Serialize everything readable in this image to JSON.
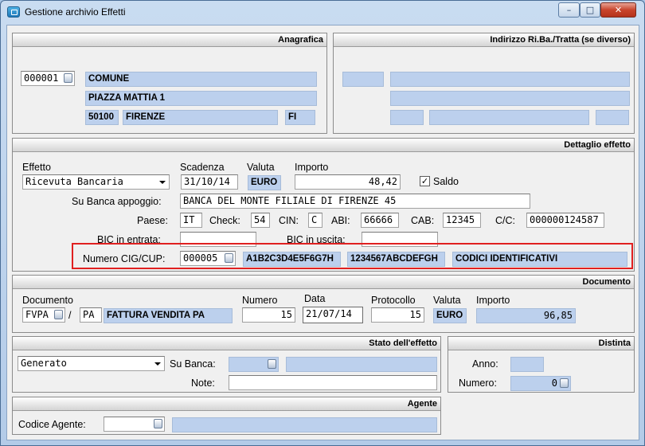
{
  "window": {
    "title": "Gestione archivio Effetti",
    "min_icon": "minimize-icon",
    "max_icon": "maximize-icon",
    "close_icon": "close-icon",
    "min_glyph": "–",
    "max_glyph": "□",
    "close_glyph": "✕"
  },
  "anagrafica": {
    "header": "Anagrafica",
    "code": "000001",
    "name": "COMUNE",
    "address": "PIAZZA MATTIA 1",
    "cap": "50100",
    "city": "FIRENZE",
    "province": "FI"
  },
  "indirizzo": {
    "header": "Indirizzo Ri.Ba./Tratta (se diverso)"
  },
  "dettaglio": {
    "header": "Dettaglio effetto",
    "effetto_label": "Effetto",
    "effetto_value": "Ricevuta Bancaria",
    "scadenza_label": "Scadenza",
    "scadenza_value": "31/10/14",
    "valuta_label": "Valuta",
    "valuta_value": "EURO",
    "importo_label": "Importo",
    "importo_value": "48,42",
    "saldo_label": "Saldo",
    "saldo_checked": "✓",
    "banca_label": "Su Banca appoggio:",
    "banca_value": "BANCA DEL MONTE FILIALE DI FIRENZE 45",
    "paese_label": "Paese:",
    "paese_value": "IT",
    "check_label": "Check:",
    "check_value": "54",
    "cin_label": "CIN:",
    "cin_value": "C",
    "abi_label": "ABI:",
    "abi_value": "66666",
    "cab_label": "CAB:",
    "cab_value": "12345",
    "cc_label": "C/C:",
    "cc_value": "000000124587",
    "bic_in_label": "BIC in entrata:",
    "bic_out_label": "BIC in uscita:",
    "cig_label": "Numero CIG/CUP:",
    "cig_code": "000005",
    "cig_value": "A1B2C3D4E5F6G7H",
    "cup_value": "1234567ABCDEFGH",
    "cig_desc": "CODICI IDENTIFICATIVI"
  },
  "documento": {
    "header": "Documento",
    "doc_label": "Documento",
    "doc_type": "FVPA",
    "slash": "/",
    "doc_series": "PA",
    "doc_desc": "FATTURA VENDITA PA",
    "numero_label": "Numero",
    "numero_value": "15",
    "data_label": "Data",
    "data_value": "21/07/14",
    "protocollo_label": "Protocollo",
    "protocollo_value": "15",
    "valuta_label": "Valuta",
    "valuta_value": "EURO",
    "importo_label": "Importo",
    "importo_value": "96,85"
  },
  "stato": {
    "header": "Stato dell'effetto",
    "stato_value": "Generato",
    "banca_label": "Su Banca:",
    "note_label": "Note:"
  },
  "distinta": {
    "header": "Distinta",
    "anno_label": "Anno:",
    "numero_label": "Numero:",
    "numero_value": "0"
  },
  "agente": {
    "header": "Agente",
    "codice_label": "Codice Agente:"
  }
}
